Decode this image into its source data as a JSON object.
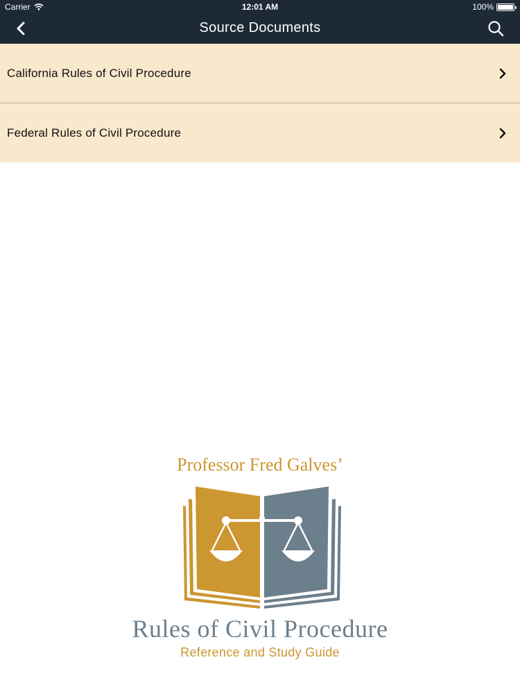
{
  "status_bar": {
    "carrier": "Carrier",
    "time": "12:01 AM",
    "battery": "100%"
  },
  "navbar": {
    "title": "Source Documents",
    "back_icon": "chevron-left-icon",
    "search_icon": "search-icon"
  },
  "list": {
    "items": [
      {
        "label": "California Rules of Civil Procedure",
        "icon": "chevron-right-icon"
      },
      {
        "label": "Federal Rules of Civil Procedure",
        "icon": "chevron-right-icon"
      }
    ]
  },
  "logo": {
    "author": "Professor Fred Galves’",
    "title": "Rules of Civil Procedure",
    "subtitle": "Reference and Study Guide"
  },
  "colors": {
    "nav_background": "#1d2a36",
    "row_background": "#f8e8cc",
    "logo_gold": "#cc9630",
    "logo_slate": "#6c7f8d"
  }
}
